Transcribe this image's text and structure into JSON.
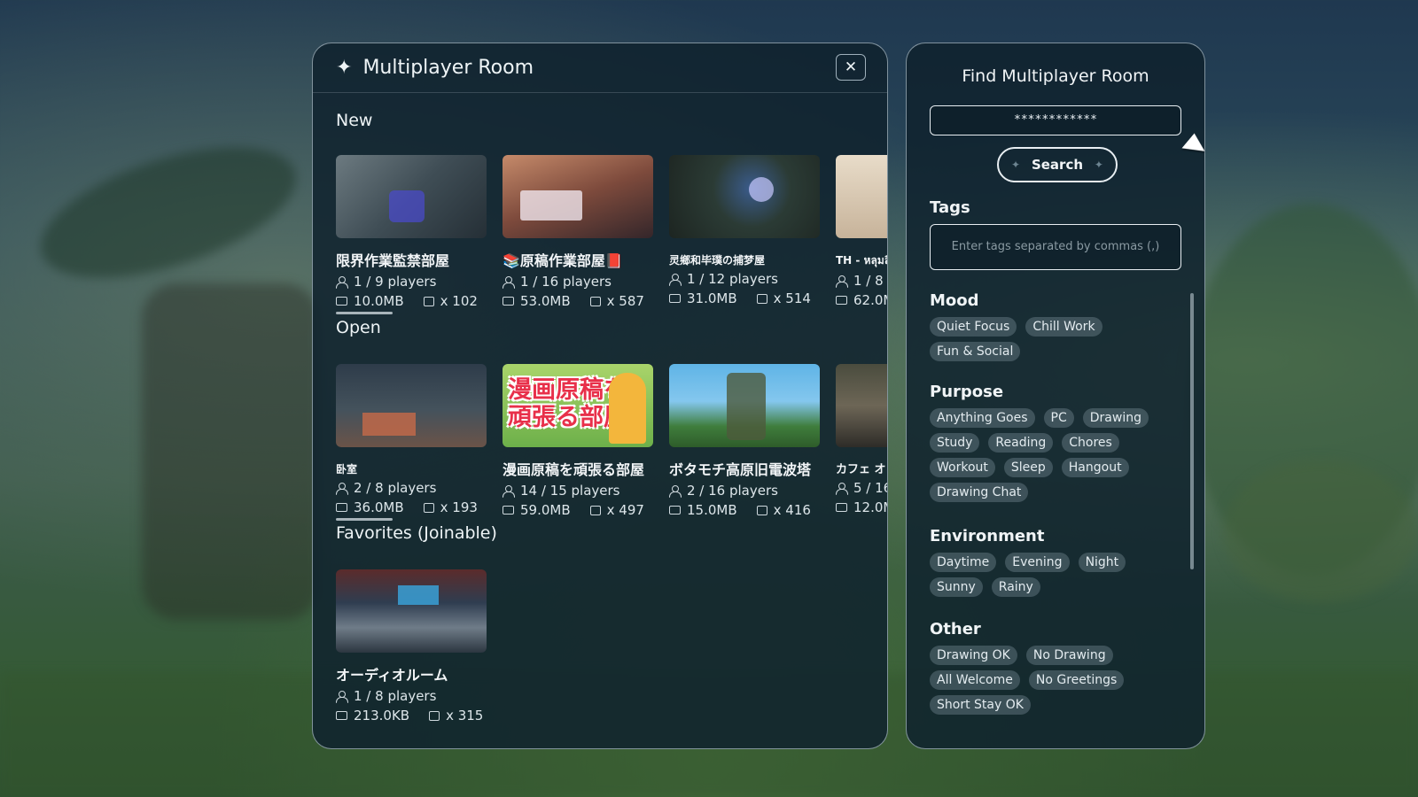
{
  "main": {
    "title": "Multiplayer Room",
    "sections": {
      "new": {
        "label": "New",
        "cards": [
          {
            "name": "限界作業監禁部屋",
            "players": "1 / 9 players",
            "size": "10.0MB",
            "count": "x 102"
          },
          {
            "name": "📚原稿作業部屋📕",
            "players": "1 / 16 players",
            "size": "53.0MB",
            "count": "x 587"
          },
          {
            "name": "灵鄉和毕璞の捕梦屋",
            "players": "1 / 12 players",
            "size": "31.0MB",
            "count": "x 514"
          },
          {
            "name": "TH - หลุมลึ",
            "players": "1 / 8",
            "size": "62.0M",
            "count": ""
          }
        ]
      },
      "open": {
        "label": "Open",
        "cards": [
          {
            "name": "卧室",
            "players": "2 / 8 players",
            "size": "36.0MB",
            "count": "x 193"
          },
          {
            "name": "漫画原稿を頑張る部屋",
            "thumb_text": "漫画原稿を頑張る部屋",
            "players": "14 / 15 players",
            "size": "59.0MB",
            "count": "x 497"
          },
          {
            "name": "ボタモチ高原旧電波塔",
            "players": "2 / 16 players",
            "size": "15.0MB",
            "count": "x 416"
          },
          {
            "name": "カフェ オ",
            "players": "5 / 16",
            "size": "12.0M",
            "count": ""
          }
        ]
      },
      "favorites": {
        "label": "Favorites (Joinable)",
        "cards": [
          {
            "name": "オーディオルーム",
            "players": "1 / 8 players",
            "size": "213.0KB",
            "count": "x 315"
          }
        ]
      }
    }
  },
  "side": {
    "title": "Find Multiplayer Room",
    "search_value": "************",
    "search_button": "Search",
    "tags_label": "Tags",
    "tags_placeholder": "Enter tags separated by commas (,)",
    "categories": [
      {
        "title": "Mood",
        "tags": [
          "Quiet Focus",
          "Chill Work",
          "Fun & Social"
        ]
      },
      {
        "title": "Purpose",
        "tags": [
          "Anything Goes",
          "PC",
          "Drawing",
          "Study",
          "Reading",
          "Chores",
          "Workout",
          "Sleep",
          "Hangout",
          "Drawing Chat"
        ]
      },
      {
        "title": "Environment",
        "tags": [
          "Daytime",
          "Evening",
          "Night",
          "Sunny",
          "Rainy"
        ]
      },
      {
        "title": "Other",
        "tags": [
          "Drawing OK",
          "No Drawing",
          "All Welcome",
          "No Greetings",
          "Short Stay OK"
        ]
      }
    ]
  }
}
